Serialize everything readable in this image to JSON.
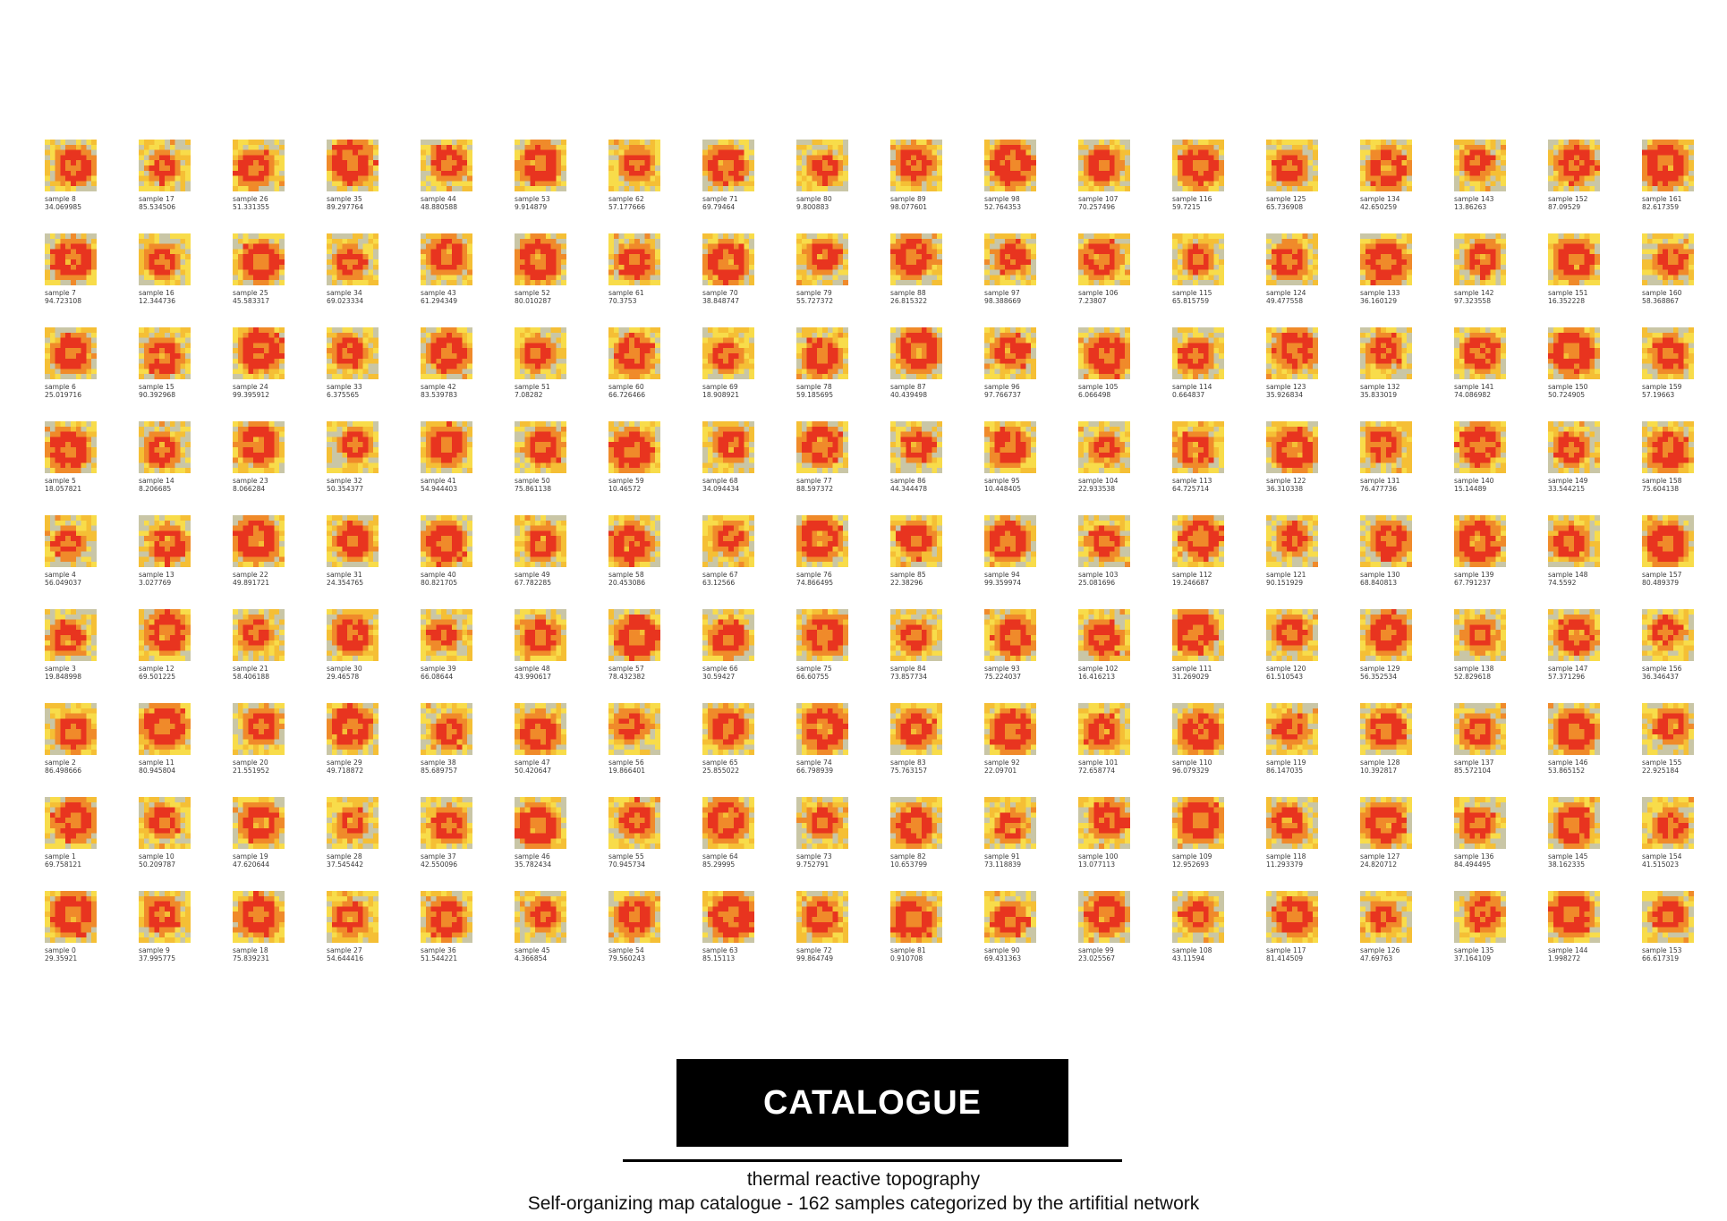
{
  "colors": {
    "deep": "#e8341f",
    "mid": "#f08a2a",
    "warm": "#f5bf35",
    "light": "#f8dc4a",
    "grey": "#c9c6a6"
  },
  "footer": {
    "title": "CATALOGUE",
    "subtitle": "thermal reactive topography",
    "caption": "Self-organizing map catalogue - 162 samples categorized by the artifitial network"
  },
  "columns": [
    [
      "34.069985",
      "94.723108",
      "25.019716",
      "18.057821",
      "56.049037",
      "19.848998",
      "86.498666",
      "69.758121",
      "29.35921"
    ],
    [
      "85.534506",
      "12.344736",
      "90.392968",
      "8.206685",
      "3.027769",
      "69.501225",
      "80.945804",
      "50.209787",
      "37.995775"
    ],
    [
      "51.331355",
      "45.583317",
      "99.395912",
      "8.066284",
      "49.891721",
      "58.406188",
      "21.551952",
      "47.620644",
      "75.839231"
    ],
    [
      "89.297764",
      "69.023334",
      "6.375565",
      "50.354377",
      "24.354765",
      "29.46578",
      "49.718872",
      "37.545442",
      "54.644416"
    ],
    [
      "48.880588",
      "61.294349",
      "83.539783",
      "54.944403",
      "80.821705",
      "66.08644",
      "85.689757",
      "42.550096",
      "51.544221"
    ],
    [
      "9.914879",
      "80.010287",
      "7.08282",
      "75.861138",
      "67.782285",
      "43.990617",
      "50.420647",
      "35.782434",
      "4.366854"
    ],
    [
      "57.177666",
      "70.3753",
      "66.726466",
      "10.46572",
      "20.453086",
      "78.432382",
      "19.866401",
      "70.945734",
      "79.560243"
    ],
    [
      "69.79464",
      "38.848747",
      "18.908921",
      "34.094434",
      "63.12566",
      "30.59427",
      "25.855022",
      "85.29995",
      "85.15113"
    ],
    [
      "9.800883",
      "55.727372",
      "59.185695",
      "88.597372",
      "74.866495",
      "66.60755",
      "66.798939",
      "9.752791",
      "99.864749"
    ],
    [
      "98.077601",
      "26.815322",
      "40.439498",
      "44.344478",
      "22.38296",
      "73.857734",
      "75.763157",
      "10.653799",
      "0.910708"
    ],
    [
      "52.764353",
      "98.388669",
      "97.766737",
      "10.448405",
      "99.359974",
      "75.224037",
      "22.09701",
      "73.118839",
      "69.431363"
    ],
    [
      "70.257496",
      "7.23807",
      "6.066498",
      "22.933538",
      "25.081696",
      "16.416213",
      "72.658774",
      "13.077113",
      "23.025567"
    ],
    [
      "59.7215",
      "65.815759",
      "0.664837",
      "64.725714",
      "19.246687",
      "31.269029",
      "96.079329",
      "12.952693",
      "43.11594"
    ],
    [
      "65.736908",
      "49.477558",
      "35.926834",
      "36.310338",
      "90.151929",
      "61.510543",
      "86.147035",
      "11.293379",
      "81.414509"
    ],
    [
      "42.650259",
      "36.160129",
      "35.833019",
      "76.477736",
      "68.840813",
      "56.352534",
      "10.392817",
      "24.820712",
      "47.69763"
    ],
    [
      "13.86263",
      "97.323558",
      "74.086982",
      "15.14489",
      "67.791237",
      "52.829618",
      "85.572104",
      "84.494495",
      "37.164109"
    ],
    [
      "87.09529",
      "16.352228",
      "50.724905",
      "33.544215",
      "74.5592",
      "57.371296",
      "53.865152",
      "38.162335",
      "1.998272"
    ],
    [
      "82.617359",
      "58.368867",
      "57.19663",
      "75.604138",
      "80.489379",
      "36.346437",
      "22.925184",
      "41.515023",
      "66.617319"
    ]
  ]
}
